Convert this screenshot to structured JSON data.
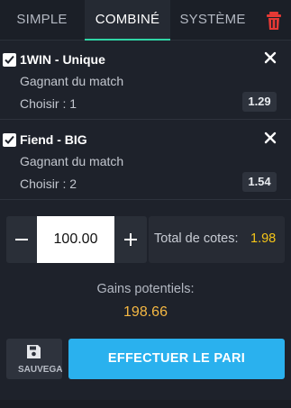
{
  "tabs": {
    "simple": "SIMPLE",
    "combine": "COMBINÉ",
    "systeme": "SYSTÈME",
    "active": "COMBINÉ"
  },
  "bets": [
    {
      "title": "1WIN - Unique",
      "market": "Gagnant du match",
      "choice": "Choisir : 1",
      "odd": "1.29",
      "checked": true
    },
    {
      "title": "Fiend - BIG",
      "market": "Gagnant du match",
      "choice": "Choisir : 2",
      "odd": "1.54",
      "checked": true
    }
  ],
  "stake": {
    "value": "100.00",
    "minus": "−",
    "plus": "+"
  },
  "total": {
    "label": "Total de cotes:",
    "value": "1.98"
  },
  "gains": {
    "label": "Gains potentiels:",
    "value": "198.66"
  },
  "actions": {
    "save_label": "SAUVEGARDER",
    "place_bet_label": "EFFECTUER LE PARI"
  },
  "icons": {
    "trash": "trash-icon",
    "close": "close-icon",
    "check": "checkbox-icon",
    "save": "floppy-disk-icon"
  },
  "colors": {
    "accent_tab": "#2fd6a6",
    "trash": "#e53935",
    "odds_total": "#f5c518",
    "gains": "#f5b843",
    "bet_button": "#2ab1ee"
  }
}
